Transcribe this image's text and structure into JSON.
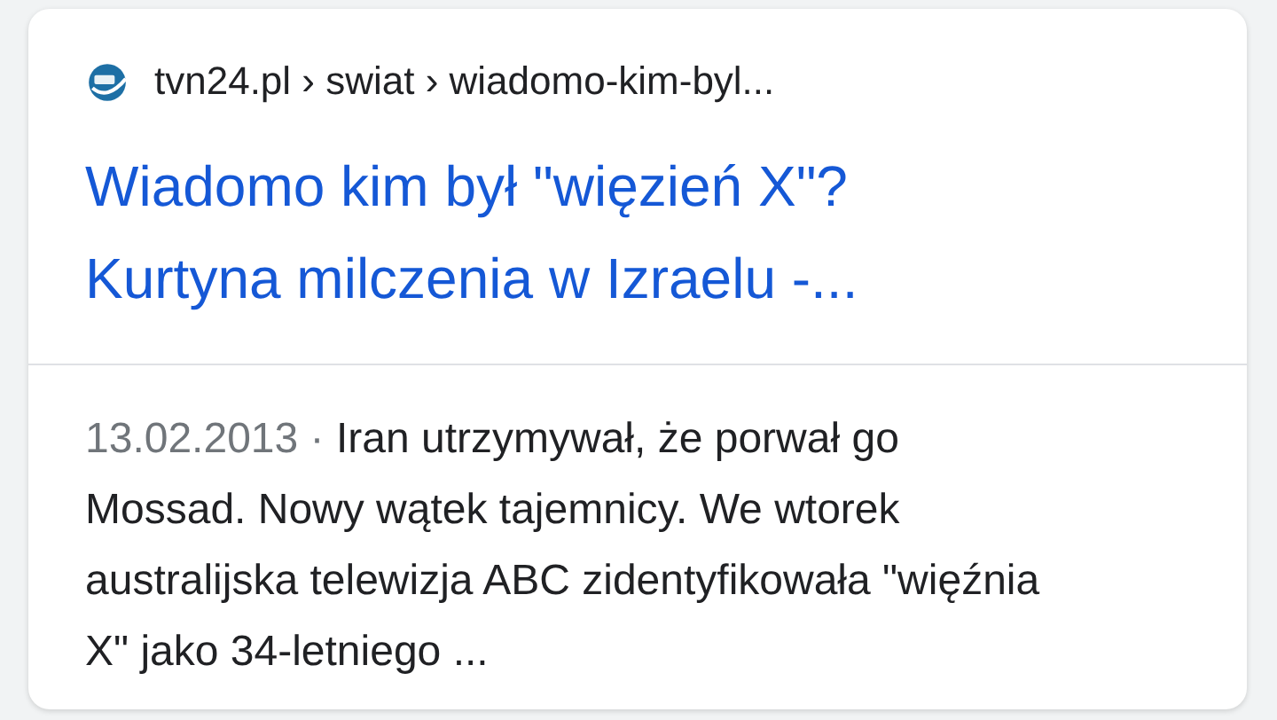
{
  "result": {
    "breadcrumb": "tvn24.pl › swiat › wiadomo-kim-byl...",
    "title": "Wiadomo kim był \"więzień X\"? Kurtyna milczenia w Izraelu -...",
    "date": "13.02.2013",
    "separator": "·",
    "snippet": "Iran utrzymywał, że porwał go Mossad. Nowy wątek tajemnicy. We wtorek australijska telewizja ABC zidentyfikowała \"więźnia X\" jako 34-letniego ..."
  }
}
